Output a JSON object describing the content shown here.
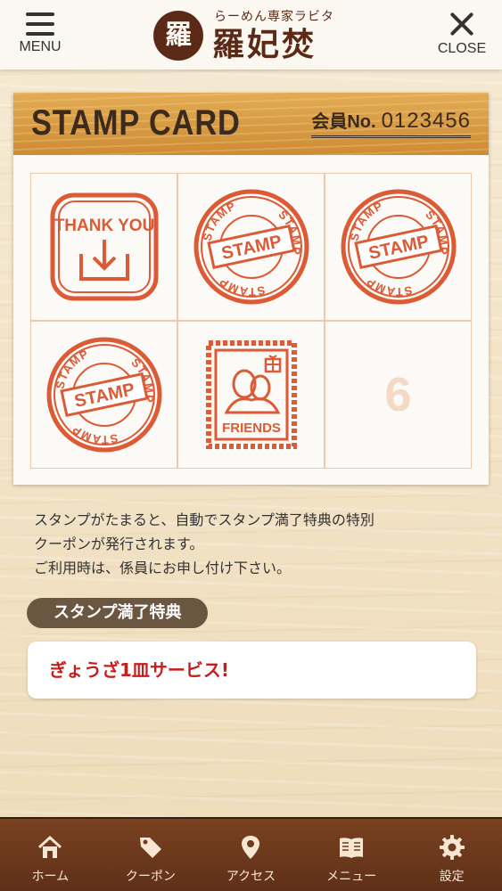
{
  "header": {
    "menu_label": "MENU",
    "close_label": "CLOSE",
    "logo_seal": "羅",
    "logo_sub": "らーめん専家ラビタ",
    "logo_main": "羅妃焚"
  },
  "card": {
    "title": "STAMP CARD",
    "member_label": "会員No.",
    "member_number": "0123456",
    "stamp_text_thank": "THANK YOU",
    "stamp_text_ring": "STAMP",
    "stamp_text_center": "STAMP",
    "stamp_text_friends": "FRIENDS",
    "empty_slot_number": "6",
    "stamps_collected": 5,
    "stamps_total": 6
  },
  "description": {
    "line1": "スタンプがたまると、自動でスタンプ満了特典の特別",
    "line2": "クーポンが発行されます。",
    "line3": "ご利用時は、係員にお申し付け下さい。"
  },
  "reward": {
    "heading": "スタンプ満了特典",
    "text": "ぎょうざ1皿サービス!"
  },
  "tabs": [
    {
      "label": "ホーム",
      "icon": "home-icon"
    },
    {
      "label": "クーポン",
      "icon": "coupon-tag-icon"
    },
    {
      "label": "アクセス",
      "icon": "map-pin-icon"
    },
    {
      "label": "メニュー",
      "icon": "book-icon"
    },
    {
      "label": "設定",
      "icon": "gear-icon"
    }
  ],
  "colors": {
    "stamp": "#dc5a35",
    "tabbar": "#6e3b1d",
    "reward_text": "#c81d1d",
    "card_header": "#d89a45"
  }
}
